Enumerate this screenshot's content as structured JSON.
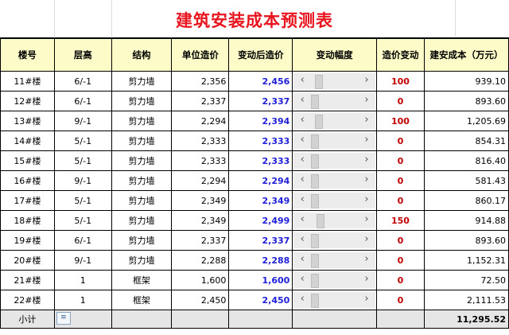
{
  "title": "建筑安装成本预测表",
  "headers": [
    "楼号",
    "层高",
    "结构",
    "单位造价",
    "变动后造价",
    "变动幅度",
    "造价变动",
    "建安成本（万元）"
  ],
  "rows": [
    {
      "building": "11#楼",
      "floors": "6/-1",
      "structure": "剪力墙",
      "unit_cost": "2,356",
      "adjusted_cost": "2,456",
      "slider_value": 1.0,
      "change": "100",
      "total": "939.10"
    },
    {
      "building": "12#楼",
      "floors": "6/-1",
      "structure": "剪力墙",
      "unit_cost": "2,337",
      "adjusted_cost": "2,337",
      "slider_value": 0.0,
      "change": "0",
      "total": "893.60"
    },
    {
      "building": "13#楼",
      "floors": "9/-1",
      "structure": "剪力墙",
      "unit_cost": "2,294",
      "adjusted_cost": "2,394",
      "slider_value": 1.0,
      "change": "100",
      "total": "1,205.69"
    },
    {
      "building": "14#楼",
      "floors": "5/-1",
      "structure": "剪力墙",
      "unit_cost": "2,333",
      "adjusted_cost": "2,333",
      "slider_value": 0.0,
      "change": "0",
      "total": "854.31"
    },
    {
      "building": "15#楼",
      "floors": "5/-1",
      "structure": "剪力墙",
      "unit_cost": "2,333",
      "adjusted_cost": "2,333",
      "slider_value": 0.0,
      "change": "0",
      "total": "816.40"
    },
    {
      "building": "16#楼",
      "floors": "9/-1",
      "structure": "剪力墙",
      "unit_cost": "2,294",
      "adjusted_cost": "2,294",
      "slider_value": 0.0,
      "change": "0",
      "total": "581.43"
    },
    {
      "building": "17#楼",
      "floors": "5/-1",
      "structure": "剪力墙",
      "unit_cost": "2,349",
      "adjusted_cost": "2,349",
      "slider_value": 0.0,
      "change": "0",
      "total": "860.17"
    },
    {
      "building": "18#楼",
      "floors": "5/-1",
      "structure": "剪力墙",
      "unit_cost": "2,349",
      "adjusted_cost": "2,499",
      "slider_value": 1.5,
      "change": "150",
      "total": "914.88"
    },
    {
      "building": "19#楼",
      "floors": "6/-1",
      "structure": "剪力墙",
      "unit_cost": "2,337",
      "adjusted_cost": "2,337",
      "slider_value": 0.0,
      "change": "0",
      "total": "893.60"
    },
    {
      "building": "20#楼",
      "floors": "9/-1",
      "structure": "剪力墙",
      "unit_cost": "2,288",
      "adjusted_cost": "2,288",
      "slider_value": 0.0,
      "change": "0",
      "total": "1,152.31"
    },
    {
      "building": "21#楼",
      "floors": "1",
      "structure": "框架",
      "unit_cost": "1,600",
      "adjusted_cost": "1,600",
      "slider_value": 0.0,
      "change": "0",
      "total": "72.50"
    },
    {
      "building": "22#楼",
      "floors": "1",
      "structure": "框架",
      "unit_cost": "2,450",
      "adjusted_cost": "2,450",
      "slider_value": 0.0,
      "change": "0",
      "total": "2,111.53"
    }
  ],
  "summary": {
    "label": "小计",
    "total": "11,295.52"
  },
  "scroll_left_glyph": "‹",
  "scroll_right_glyph": "›",
  "colors": {
    "title": "#e8141e",
    "header_bg": "#fdfcc8",
    "adjusted": "#1f1fd8",
    "change": "#c00000"
  }
}
